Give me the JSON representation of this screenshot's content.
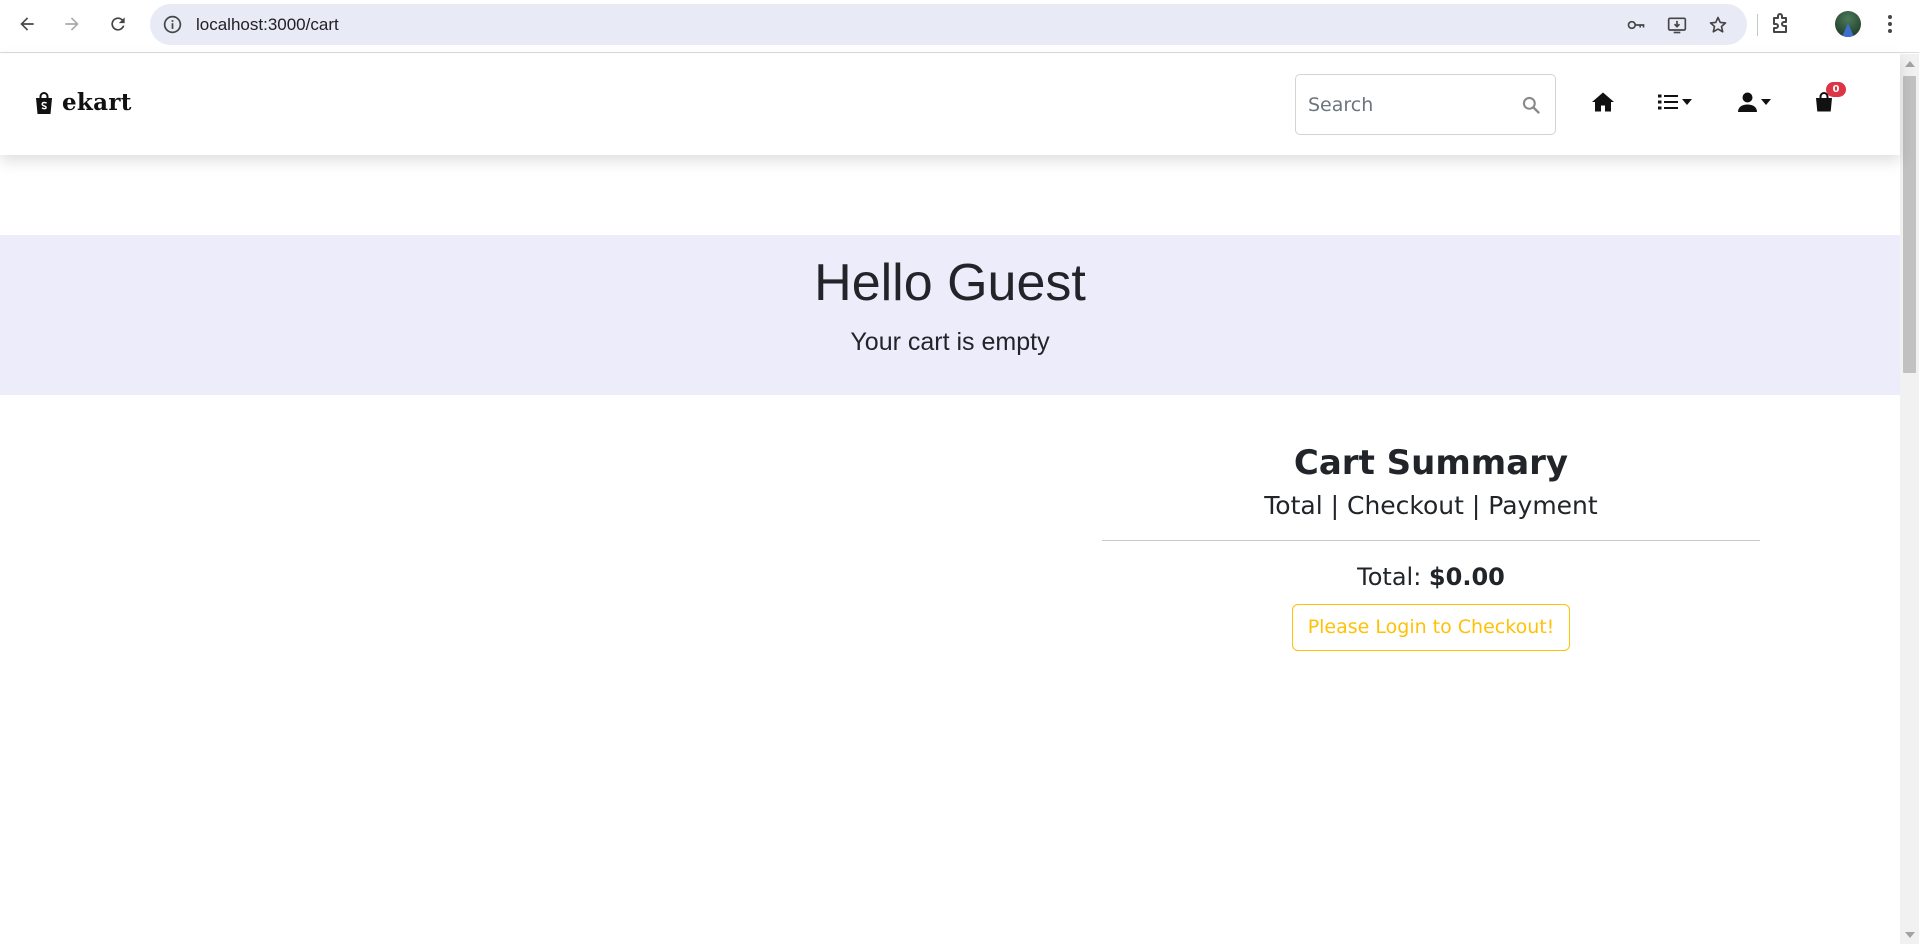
{
  "browser": {
    "url": "localhost:3000/cart",
    "icons": [
      "back-icon",
      "forward-icon",
      "reload-icon",
      "site-info-icon",
      "password-key-icon",
      "install-app-icon",
      "bookmark-star-icon",
      "extensions-icon",
      "profile-avatar",
      "more-menu-icon"
    ]
  },
  "navbar": {
    "brand_name": "ekart",
    "brand_icon": "shopping-bag-icon",
    "search_placeholder": "Search",
    "search_value": "",
    "cart_count": "0",
    "icons": [
      "home-icon",
      "categories-list-icon",
      "user-icon",
      "cart-bag-icon"
    ]
  },
  "hero": {
    "title": "Hello Guest",
    "subtitle": "Your cart is empty"
  },
  "summary": {
    "title": "Cart Summary",
    "subtitle": "Total | Checkout | Payment",
    "total_label": "Total:",
    "total_value": "$0.00",
    "checkout_button": "Please Login to Checkout!"
  },
  "colors": {
    "hero_background": "#ececfb",
    "checkout_accent": "#ffc107",
    "cart_badge": "#dc3545",
    "omnibox_background": "#e8eaf6"
  }
}
